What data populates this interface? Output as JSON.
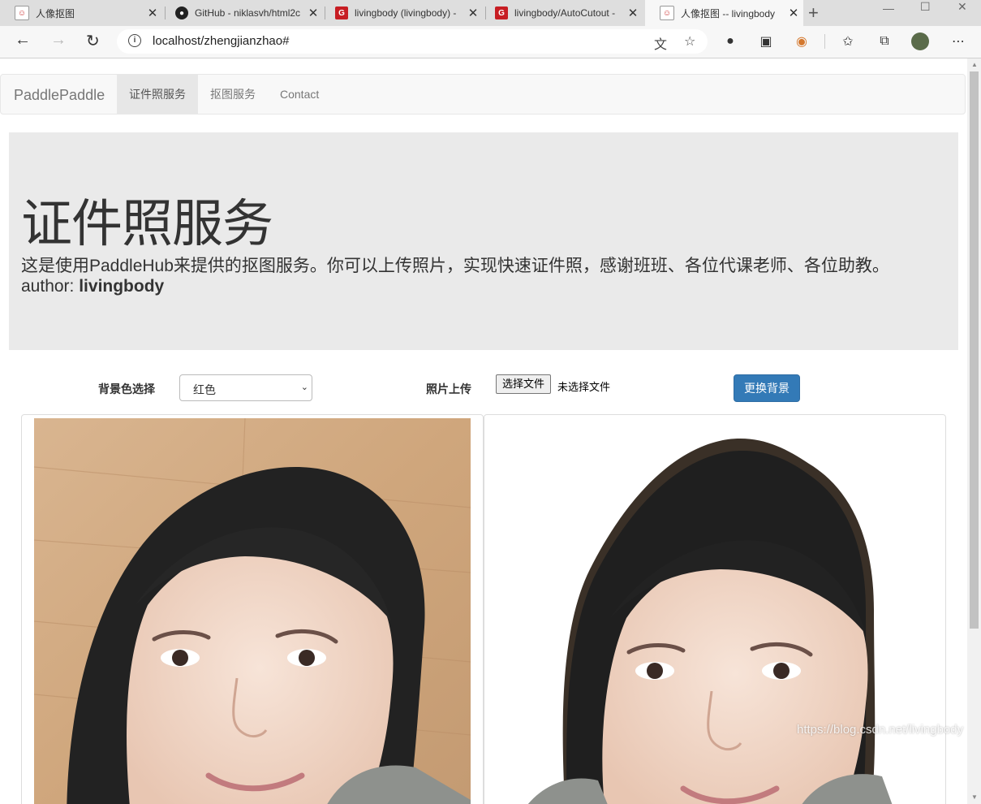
{
  "browser": {
    "tabs": [
      {
        "title": "人像抠图",
        "icon": "doll-favicon-icon",
        "active": false
      },
      {
        "title": "GitHub - niklasvh/html2c",
        "icon": "github-favicon-icon",
        "active": false
      },
      {
        "title": "livingbody (livingbody) -",
        "icon": "gitee-favicon-icon",
        "active": false
      },
      {
        "title": "livingbody/AutoCutout -",
        "icon": "gitee-favicon-icon",
        "active": false
      },
      {
        "title": "人像抠图 -- livingbody",
        "icon": "doll-favicon-icon",
        "active": true
      }
    ],
    "url": "localhost/zhengjianzhao#"
  },
  "nav": {
    "brand": "PaddlePaddle",
    "links": [
      "证件照服务",
      "抠图服务",
      "Contact"
    ]
  },
  "hero": {
    "title": "证件照服务",
    "description": "这是使用PaddleHub来提供的抠图服务。你可以上传照片，实现快速证件照，感谢班班、各位代课老师、各位助教。",
    "author_prefix": "author: ",
    "author_name": "livingbody"
  },
  "controls": {
    "bg_label": "背景色选择",
    "bg_selected": "红色",
    "upload_label": "照片上传",
    "file_button": "选择文件",
    "file_status": "未选择文件",
    "submit": "更换背景"
  },
  "watermark": "https://blog.csdn.net/livingbody",
  "colors": {
    "primary": "#337ab7",
    "jumbotron": "#eaeaea",
    "navbar": "#f8f8f8"
  }
}
